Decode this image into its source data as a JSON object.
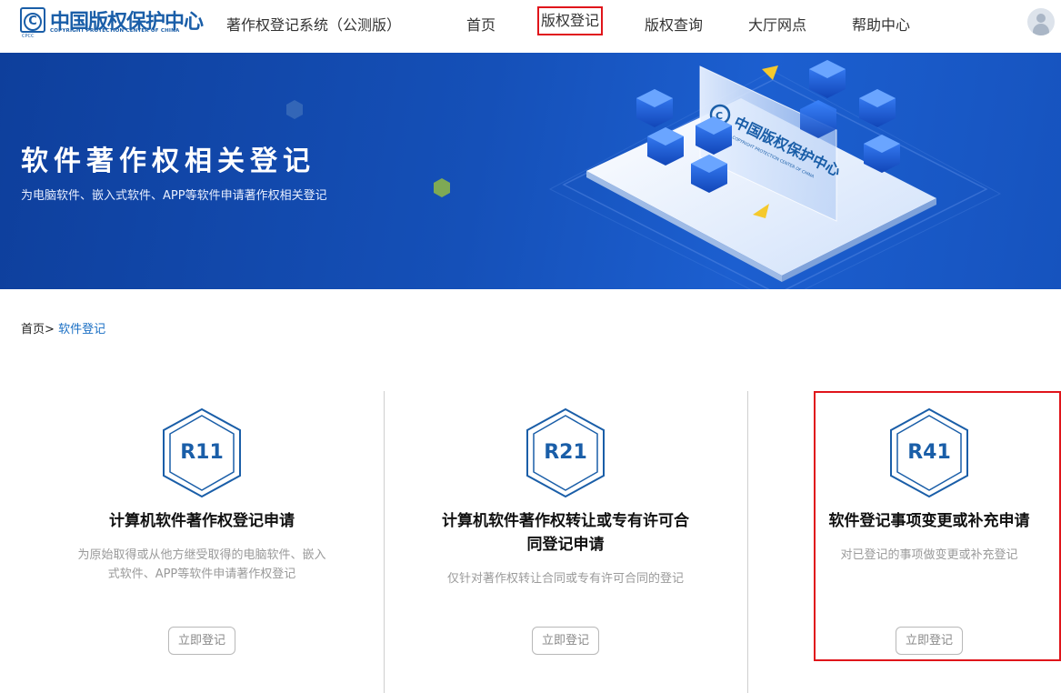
{
  "header": {
    "logo_mark": "C",
    "logo_mark_small": "CPCC",
    "logo_cn": "中国版权保护中心",
    "logo_en": "COPYRIGHT PROTECTION CENTER OF CHINA",
    "system_title": "著作权登记系统（公测版）",
    "nav": [
      {
        "label": "首页"
      },
      {
        "label": "版权登记",
        "active": true
      },
      {
        "label": "版权查询"
      },
      {
        "label": "大厅网点"
      },
      {
        "label": "帮助中心"
      }
    ]
  },
  "banner": {
    "title": "软件著作权相关登记",
    "subtitle": "为电脑软件、嵌入式软件、APP等软件申请著作权相关登记",
    "art_logo_cn": "中国版权保护中心",
    "art_logo_en": "COPYRIGHT PROTECTION CENTER OF CHINA"
  },
  "breadcrumb": {
    "home": "首页",
    "separator": ">",
    "current": "软件登记"
  },
  "cards": [
    {
      "code": "R11",
      "title_lines": [
        "计算机软件著作权登记申请"
      ],
      "desc_lines": [
        "为原始取得或从他方继受取得的电脑软件、嵌入",
        "式软件、APP等软件申请著作权登记"
      ],
      "button": "立即登记"
    },
    {
      "code": "R21",
      "title_lines": [
        "计算机软件著作权转让或专有许可合",
        "同登记申请"
      ],
      "desc_lines": [
        "仅针对著作权转让合同或专有许可合同的登记"
      ],
      "button": "立即登记"
    },
    {
      "code": "R41",
      "title_lines": [
        "软件登记事项变更或补充申请"
      ],
      "desc_lines": [
        "对已登记的事项做变更或补充登记"
      ],
      "button": "立即登记",
      "highlighted": true
    }
  ],
  "colors": {
    "brand_blue": "#1a5ea8",
    "link_blue": "#1a6fc4",
    "highlight_red": "#e0151b",
    "banner_blue": "#1550b8"
  }
}
